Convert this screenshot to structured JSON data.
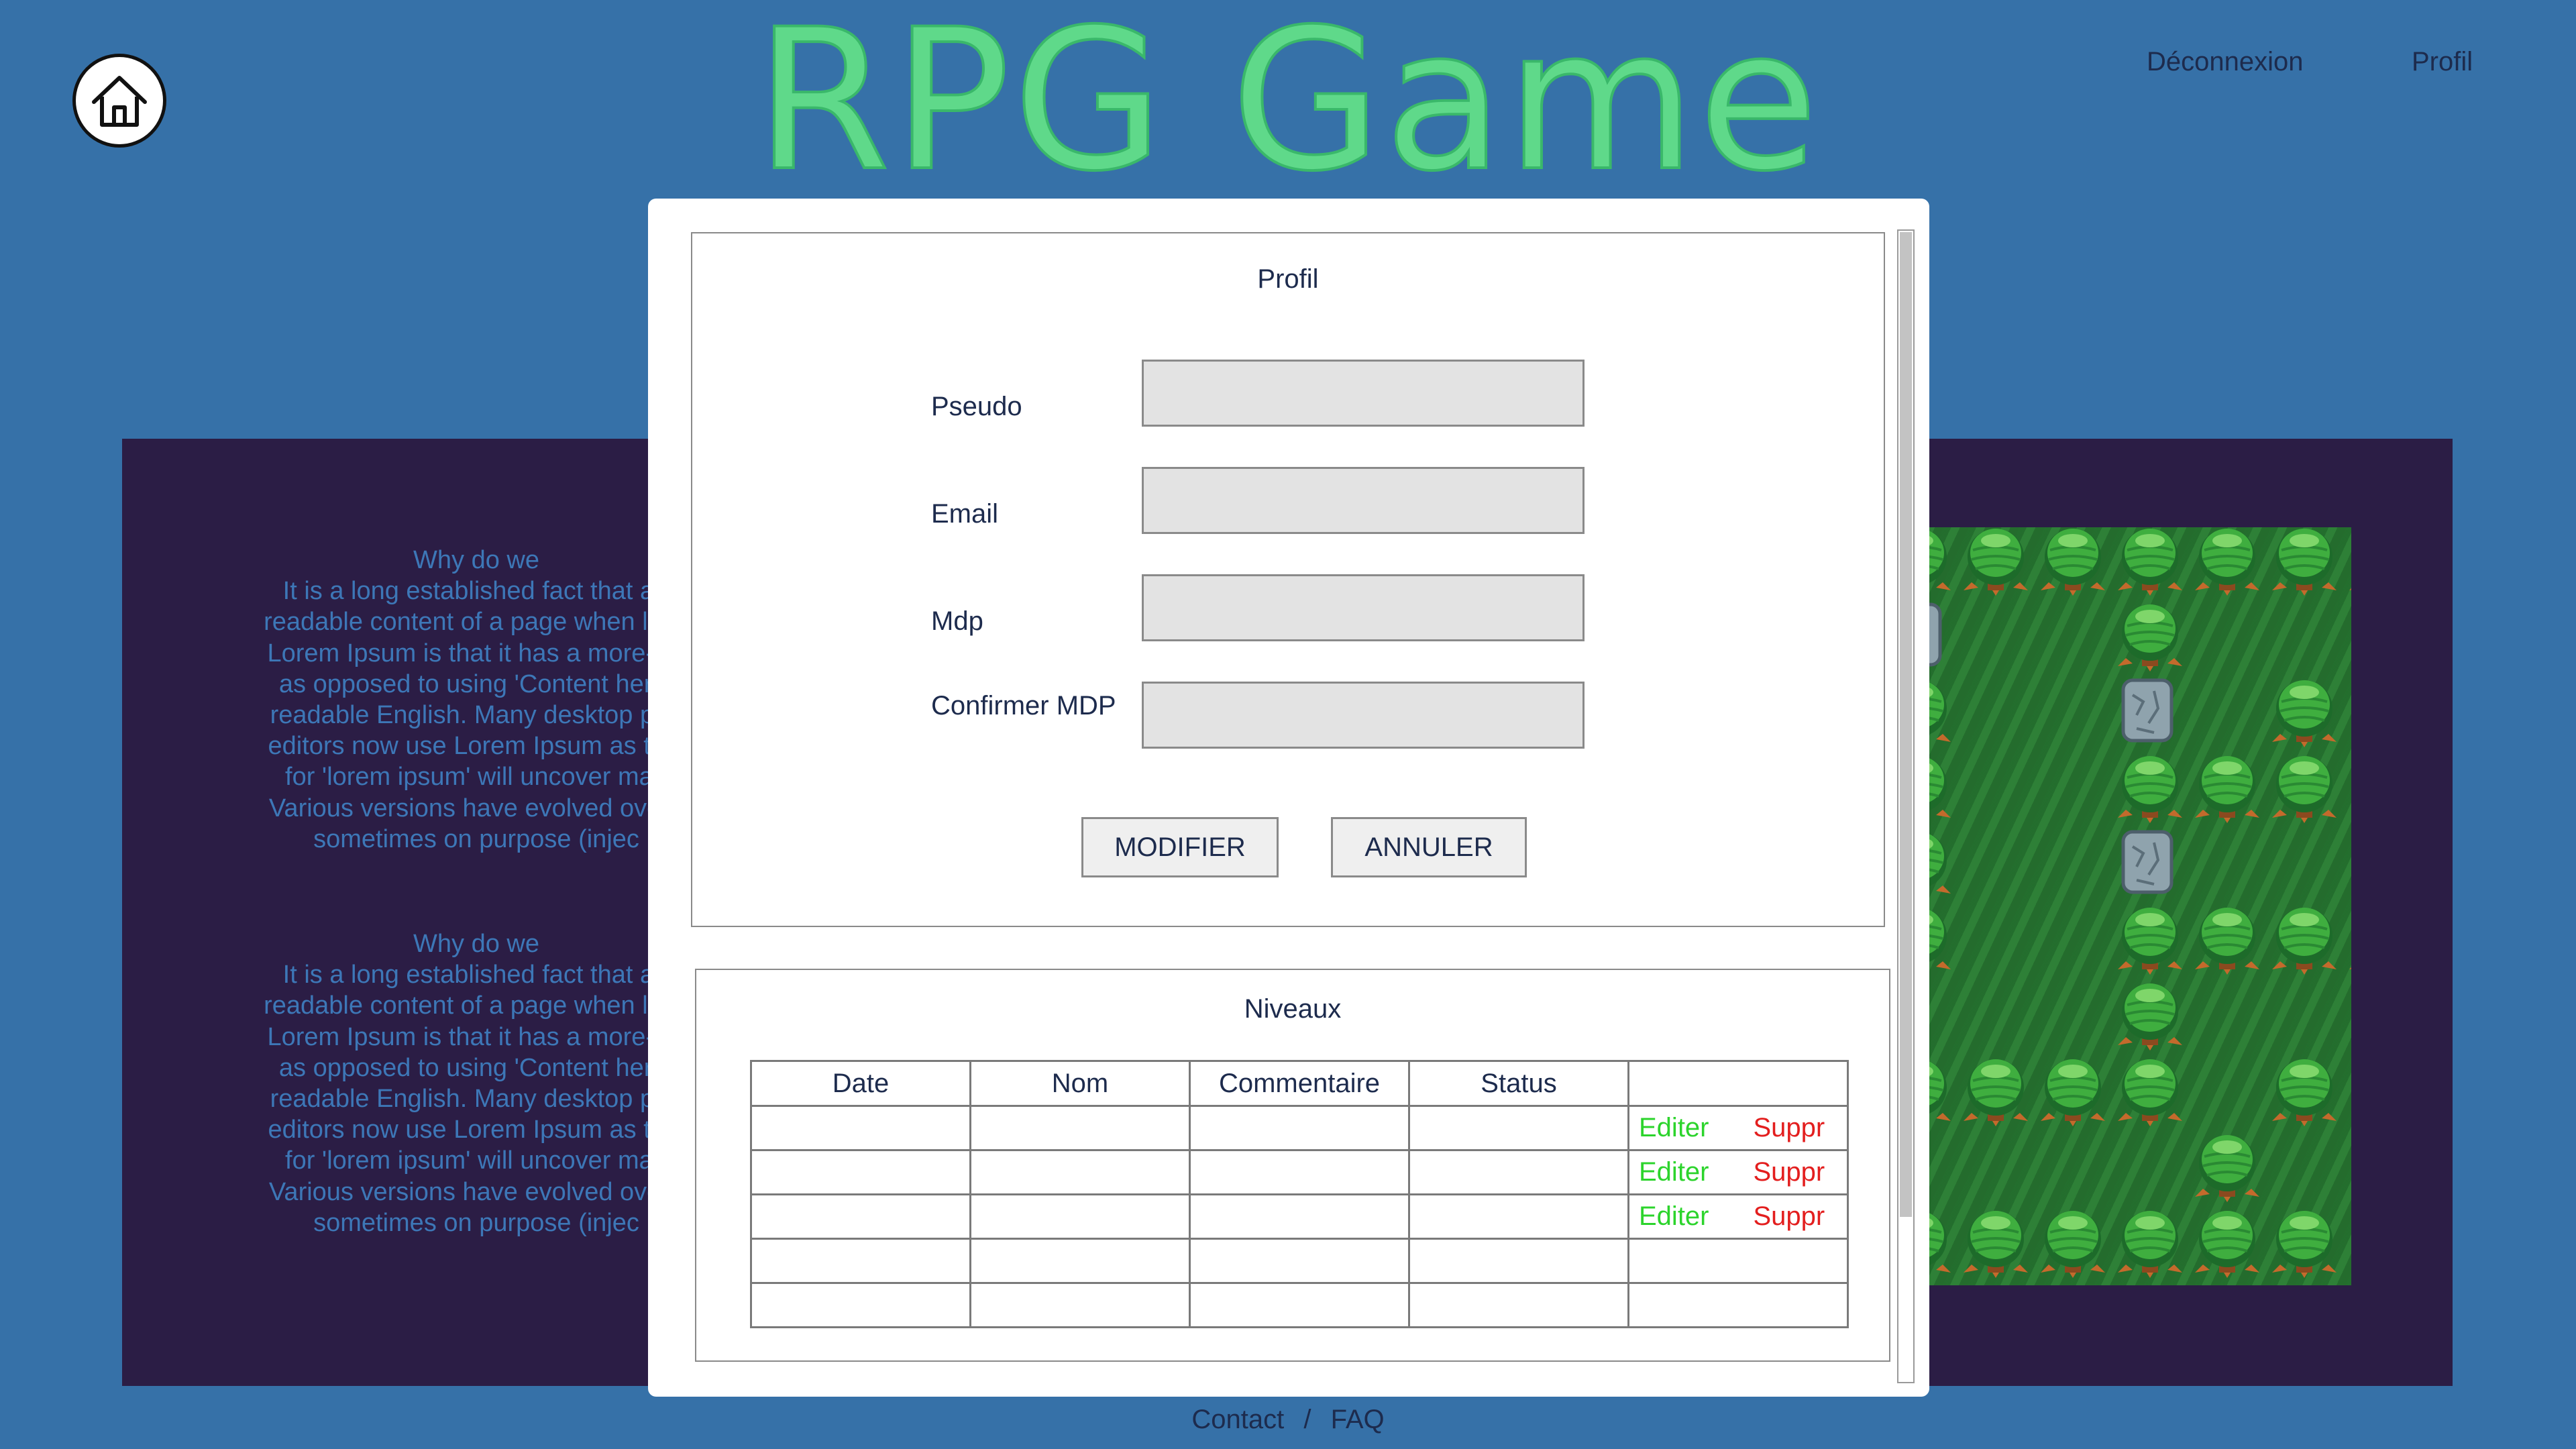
{
  "header": {
    "title": "RPG Game",
    "logout_label": "Déconnexion",
    "profile_label": "Profil",
    "home_icon": "home-icon"
  },
  "background_text": {
    "block1": "Why do we\nIt is a long established fact that a r\nreadable content of a page when look\nLorem Ipsum is that it has a more-or-\nas opposed to using 'Content here,\nreadable English. Many desktop pub\neditors now use Lorem Ipsum as thei\nfor 'lorem ipsum' will uncover man\nVarious versions have evolved over t\nsometimes on purpose (injec",
    "block2": "Why do we\nIt is a long established fact that a r\nreadable content of a page when look\nLorem Ipsum is that it has a more-or-\nas opposed to using 'Content here,\nreadable English. Many desktop pub\neditors now use Lorem Ipsum as thei\nfor 'lorem ipsum' will uncover man\nVarious versions have evolved over t\nsometimes on purpose (injec"
  },
  "profile_form": {
    "title": "Profil",
    "fields": [
      {
        "label": "Pseudo",
        "value": ""
      },
      {
        "label": "Email",
        "value": ""
      },
      {
        "label": "Mdp",
        "value": ""
      },
      {
        "label": "Confirmer MDP",
        "value": ""
      }
    ],
    "modify_label": "MODIFIER",
    "cancel_label": "ANNULER"
  },
  "levels": {
    "title": "Niveaux",
    "columns": [
      "Date",
      "Nom",
      "Commentaire",
      "Status",
      ""
    ],
    "rows": [
      {
        "date": "",
        "nom": "",
        "commentaire": "",
        "status": "",
        "edit": "Editer",
        "delete": "Suppr"
      },
      {
        "date": "",
        "nom": "",
        "commentaire": "",
        "status": "",
        "edit": "Editer",
        "delete": "Suppr"
      },
      {
        "date": "",
        "nom": "",
        "commentaire": "",
        "status": "",
        "edit": "Editer",
        "delete": "Suppr"
      },
      {
        "date": "",
        "nom": "",
        "commentaire": "",
        "status": "",
        "edit": "",
        "delete": ""
      },
      {
        "date": "",
        "nom": "",
        "commentaire": "",
        "status": "",
        "edit": "",
        "delete": ""
      }
    ]
  },
  "footer": {
    "contact_label": "Contact",
    "separator": "/",
    "faq_label": "FAQ"
  },
  "colors": {
    "page_bg": "#3671a8",
    "panel_bg": "#2b1d45",
    "title_green": "#5fd98a",
    "edit_green": "#2cd42c",
    "delete_red": "#e31e1e"
  }
}
